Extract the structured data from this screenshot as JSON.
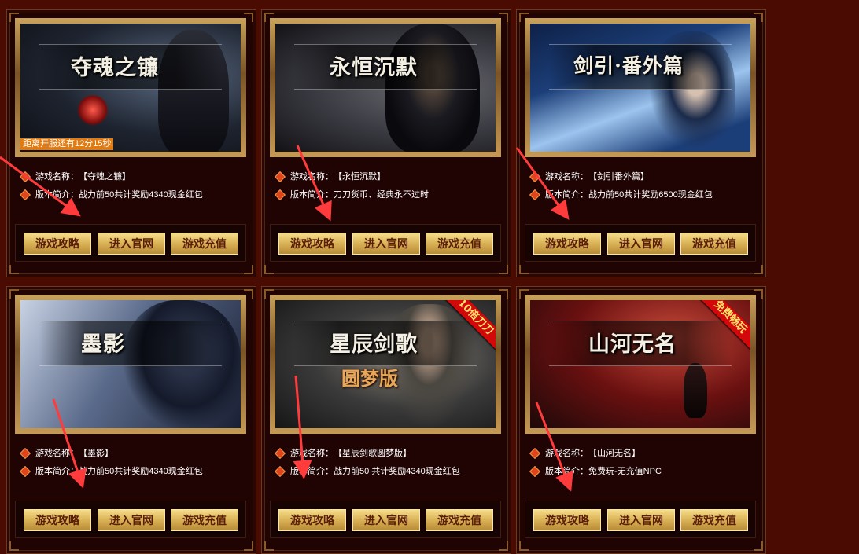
{
  "cards": [
    {
      "title": "夺魂之镰",
      "subtitle": "",
      "ribbon": "",
      "countdown": "距离开服还有12分15秒",
      "name_label": "游戏名称：",
      "name": "【夺魂之镰】",
      "desc_label": "版本简介：",
      "desc": "战力前50共计奖励4340现金红包",
      "buttons": [
        "游戏攻略",
        "进入官网",
        "游戏充值"
      ],
      "art_colors": [
        "#1e2430",
        "#5a6a82",
        "#0d0f14"
      ]
    },
    {
      "title": "永恒沉默",
      "subtitle": "",
      "ribbon": "",
      "countdown": "",
      "name_label": "游戏名称：",
      "name": "【永恒沉默】",
      "desc_label": "版本简介：",
      "desc": "刀刀货币、经典永不过时",
      "buttons": [
        "游戏攻略",
        "进入官网",
        "游戏充值"
      ],
      "art_colors": [
        "#3c3c44",
        "#6a6a70",
        "#121216"
      ]
    },
    {
      "title": "剑引·番外篇",
      "subtitle": "",
      "ribbon": "",
      "countdown": "",
      "name_label": "游戏名称：",
      "name": "【剑引番外篇】",
      "desc_label": "版本简介：",
      "desc": "战力前50共计奖励6500现金红包",
      "buttons": [
        "游戏攻略",
        "进入官网",
        "游戏充值"
      ],
      "art_colors": [
        "#1c3e78",
        "#9cc4ee",
        "#0e2148"
      ]
    },
    {
      "title": "墨影",
      "subtitle": "",
      "ribbon": "",
      "countdown": "",
      "name_label": "游戏名称：",
      "name": "【墨影】",
      "desc_label": "版本简介：",
      "desc": "战力前50共计奖励4340现金红包",
      "buttons": [
        "游戏攻略",
        "进入官网",
        "游戏充值"
      ],
      "art_colors": [
        "#5a6a8a",
        "#c8d2e4",
        "#1a2034"
      ]
    },
    {
      "title": "星辰剑歌",
      "subtitle": "圆梦版",
      "ribbon": "10倍刀刀",
      "countdown": "",
      "name_label": "游戏名称：",
      "name": "【星辰剑歌圆梦版】",
      "desc_label": "版本简介：",
      "desc": "战力前50 共计奖励4340现金红包",
      "buttons": [
        "游戏攻略",
        "进入官网",
        "游戏充值"
      ],
      "art_colors": [
        "#3a3a3a",
        "#8a8478",
        "#161616"
      ]
    },
    {
      "title": "山河无名",
      "subtitle": "",
      "ribbon": "免费畅玩",
      "countdown": "",
      "name_label": "游戏名称：",
      "name": "【山河无名】",
      "desc_label": "版本简介：",
      "desc": "免费玩-无充值NPC",
      "buttons": [
        "游戏攻略",
        "进入官网",
        "游戏充值"
      ],
      "art_colors": [
        "#6a1010",
        "#c84a3a",
        "#1c0808"
      ]
    }
  ]
}
